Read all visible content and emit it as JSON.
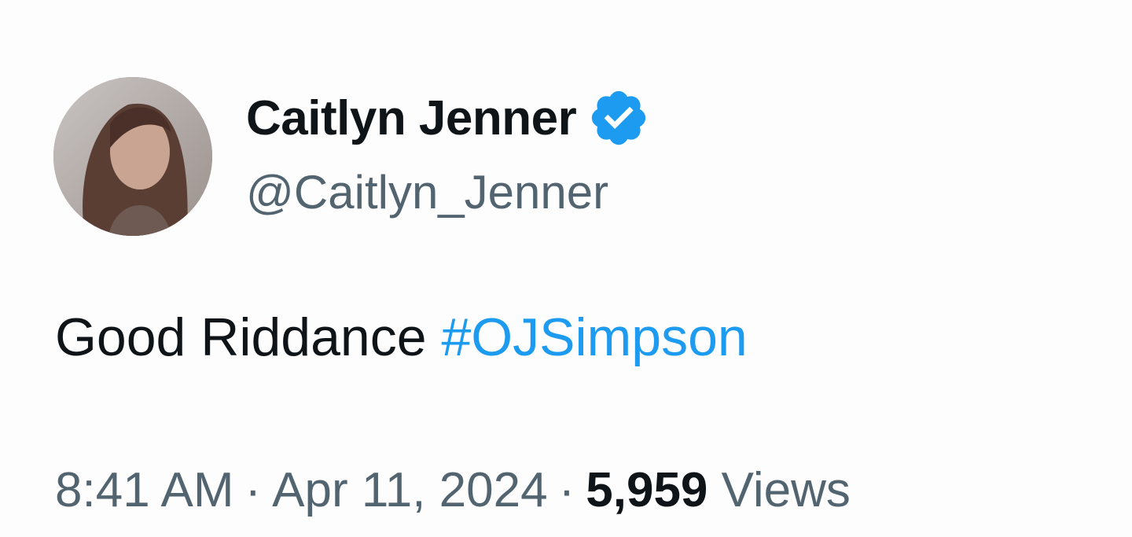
{
  "author": {
    "display_name": "Caitlyn Jenner",
    "handle": "@Caitlyn_Jenner",
    "verified": true,
    "verified_color": "#1d9bf0"
  },
  "tweet": {
    "text": "Good Riddance ",
    "hashtag": "#OJSimpson",
    "hashtag_color": "#1d9bf0"
  },
  "meta": {
    "time": "8:41 AM",
    "separator": "·",
    "date": "Apr 11, 2024",
    "views_count": "5,959",
    "views_label": "Views"
  },
  "icons": {
    "verified": "verified-badge-icon",
    "avatar": "profile-photo"
  }
}
